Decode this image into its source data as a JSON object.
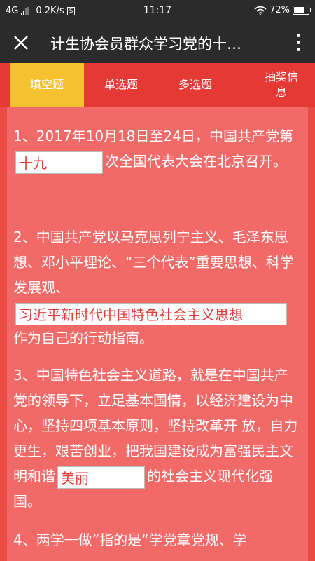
{
  "status_bar": {
    "network": "4G",
    "speed": "0.2K/s",
    "notification_icon": "S",
    "time": "11:17",
    "battery": "72%",
    "battery_level": 0.72
  },
  "header": {
    "title": "计生协会员群众学习党的十…"
  },
  "tabs": [
    {
      "label": "填空题",
      "active": true
    },
    {
      "label": "单选题",
      "active": false
    },
    {
      "label": "多选题",
      "active": false
    },
    {
      "label": "抽奖信\n息",
      "active": false
    }
  ],
  "questions": [
    {
      "prefix": "1、2017年10月18日至24日，中国共产党第",
      "answer": "十九",
      "suffix": "次全国代表大会在北京召开。"
    },
    {
      "prefix": "2、中国共产党以马克思列宁主义、毛泽东思想、邓小平理论、“三个代表”重要思想、科学发展观、",
      "answer": "习近平新时代中国特色社会主义思想",
      "suffix": "作为自己的行动指南。"
    },
    {
      "prefix": "3、中国特色社会主义道路，就是在中国共产党的领导下，立足基本国情，以经济建设为中心，坚持四项基本原则，坚持改革开 放，自力更生，艰苦创业，把我国建设成为富强民主文明和谐",
      "answer": "美丽",
      "suffix": "的社会主义现代化强国。"
    },
    {
      "prefix": "4、两学一做”指的是“学党章党规、学",
      "answer": "",
      "suffix": ""
    }
  ]
}
